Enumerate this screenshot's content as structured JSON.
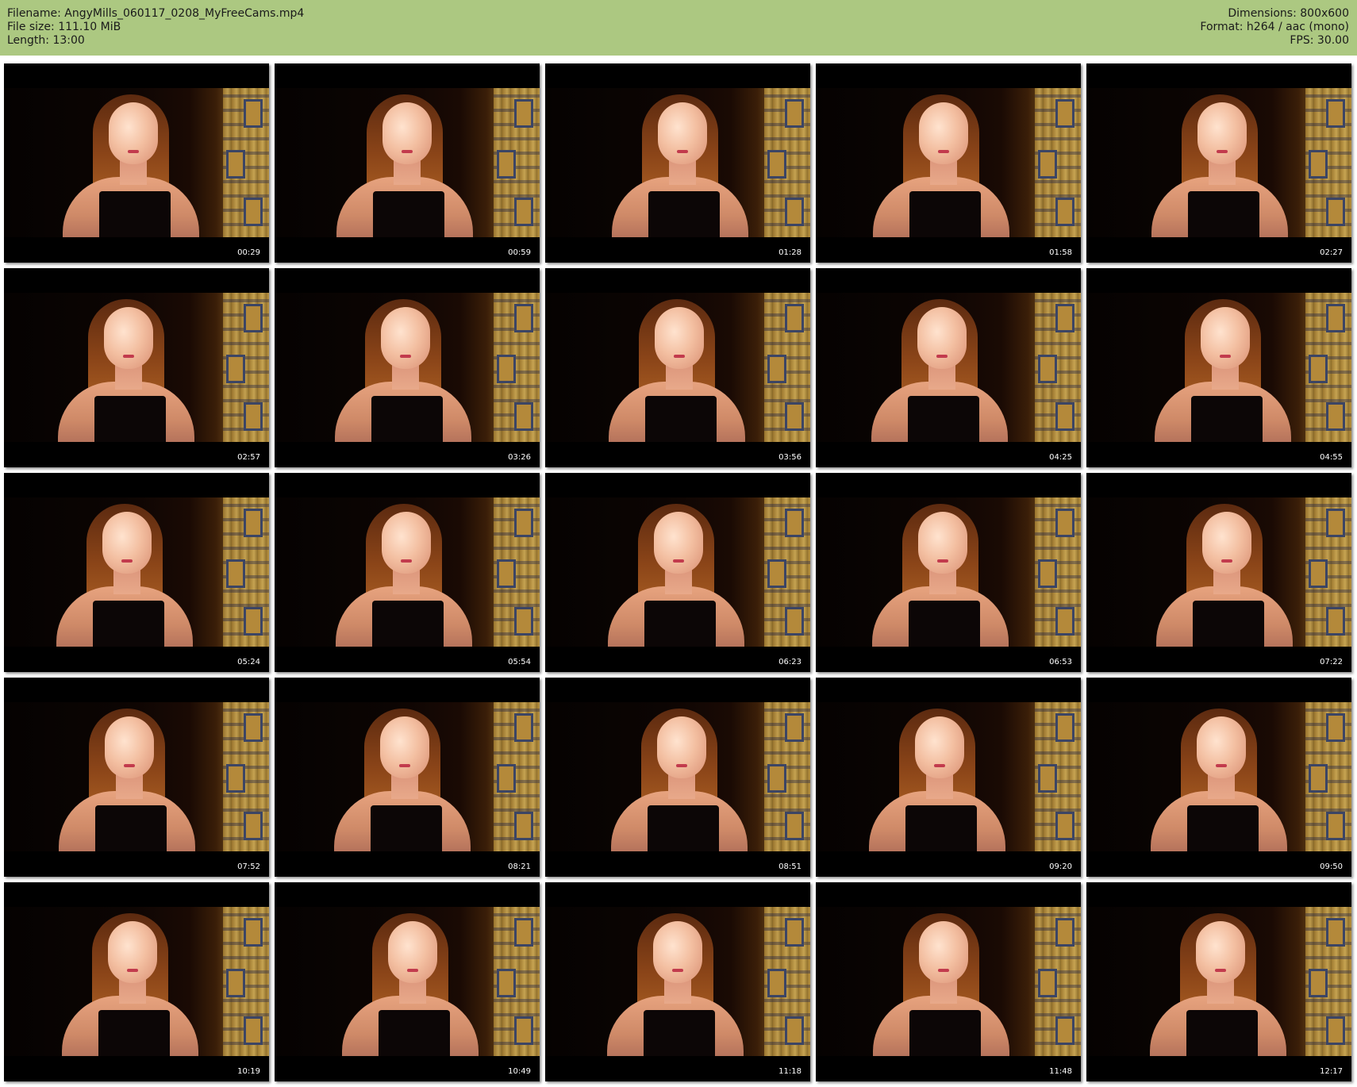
{
  "header": {
    "filename": "Filename: AngyMills_060117_0208_MyFreeCams.mp4",
    "filesize": "File size: 111.10 MiB",
    "length": "Length: 13:00",
    "dimensions": "Dimensions: 800x600",
    "format": "Format: h264 / aac (mono)",
    "fps": "FPS: 30.00",
    "background_color": "#acc881"
  },
  "thumbnails": [
    {
      "timestamp": "00:29"
    },
    {
      "timestamp": "00:59"
    },
    {
      "timestamp": "01:28"
    },
    {
      "timestamp": "01:58"
    },
    {
      "timestamp": "02:27"
    },
    {
      "timestamp": "02:57"
    },
    {
      "timestamp": "03:26"
    },
    {
      "timestamp": "03:56"
    },
    {
      "timestamp": "04:25"
    },
    {
      "timestamp": "04:55"
    },
    {
      "timestamp": "05:24"
    },
    {
      "timestamp": "05:54"
    },
    {
      "timestamp": "06:23"
    },
    {
      "timestamp": "06:53"
    },
    {
      "timestamp": "07:22"
    },
    {
      "timestamp": "07:52"
    },
    {
      "timestamp": "08:21"
    },
    {
      "timestamp": "08:51"
    },
    {
      "timestamp": "09:20"
    },
    {
      "timestamp": "09:50"
    },
    {
      "timestamp": "10:19"
    },
    {
      "timestamp": "10:49"
    },
    {
      "timestamp": "11:18"
    },
    {
      "timestamp": "11:48"
    },
    {
      "timestamp": "12:17"
    }
  ]
}
